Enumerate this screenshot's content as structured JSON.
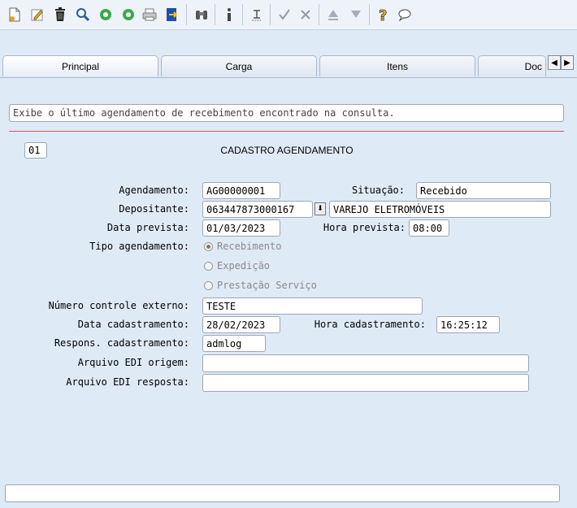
{
  "toolbar": {
    "icons": [
      "new-icon",
      "edit-icon",
      "delete-icon",
      "search-icon",
      "previous-icon",
      "next-icon",
      "print-icon",
      "exit-icon",
      "binoculars-icon",
      "info-icon",
      "list-icon",
      "confirm-icon",
      "cancel-icon",
      "up-icon",
      "down-icon",
      "help-icon",
      "chat-icon"
    ]
  },
  "tabs": [
    {
      "label": "Principal"
    },
    {
      "label": "Carga"
    },
    {
      "label": "Itens"
    },
    {
      "label": "Doc"
    }
  ],
  "message": "Exibe o último agendamento de recebimento encontrado na consulta.",
  "form": {
    "code": "01",
    "title": "CADASTRO AGENDAMENTO",
    "agendamento_label": "Agendamento:",
    "agendamento_value": "AG00000001",
    "situacao_label": "Situação:",
    "situacao_value": "Recebido",
    "depositante_label": "Depositante:",
    "depositante_code": "063447873000167",
    "depositante_name": "VAREJO ELETROMÓVEIS",
    "data_prevista_label": "Data prevista:",
    "data_prevista_value": "01/03/2023",
    "hora_prevista_label": "Hora prevista:",
    "hora_prevista_value": "08:00",
    "tipo_label": "Tipo agendamento:",
    "tipo_options": [
      "Recebimento",
      "Expedição",
      "Prestação Serviço"
    ],
    "tipo_selected": "Recebimento",
    "numero_label": "Número controle externo:",
    "numero_value": "TESTE",
    "data_cad_label": "Data cadastramento:",
    "data_cad_value": "28/02/2023",
    "hora_cad_label": "Hora cadastramento:",
    "hora_cad_value": "16:25:12",
    "respons_label": "Respons. cadastramento:",
    "respons_value": "admlog",
    "edi_origem_label": "Arquivo EDI origem:",
    "edi_origem_value": "",
    "edi_resposta_label": "Arquivo EDI resposta:",
    "edi_resposta_value": ""
  },
  "status_bar": ""
}
